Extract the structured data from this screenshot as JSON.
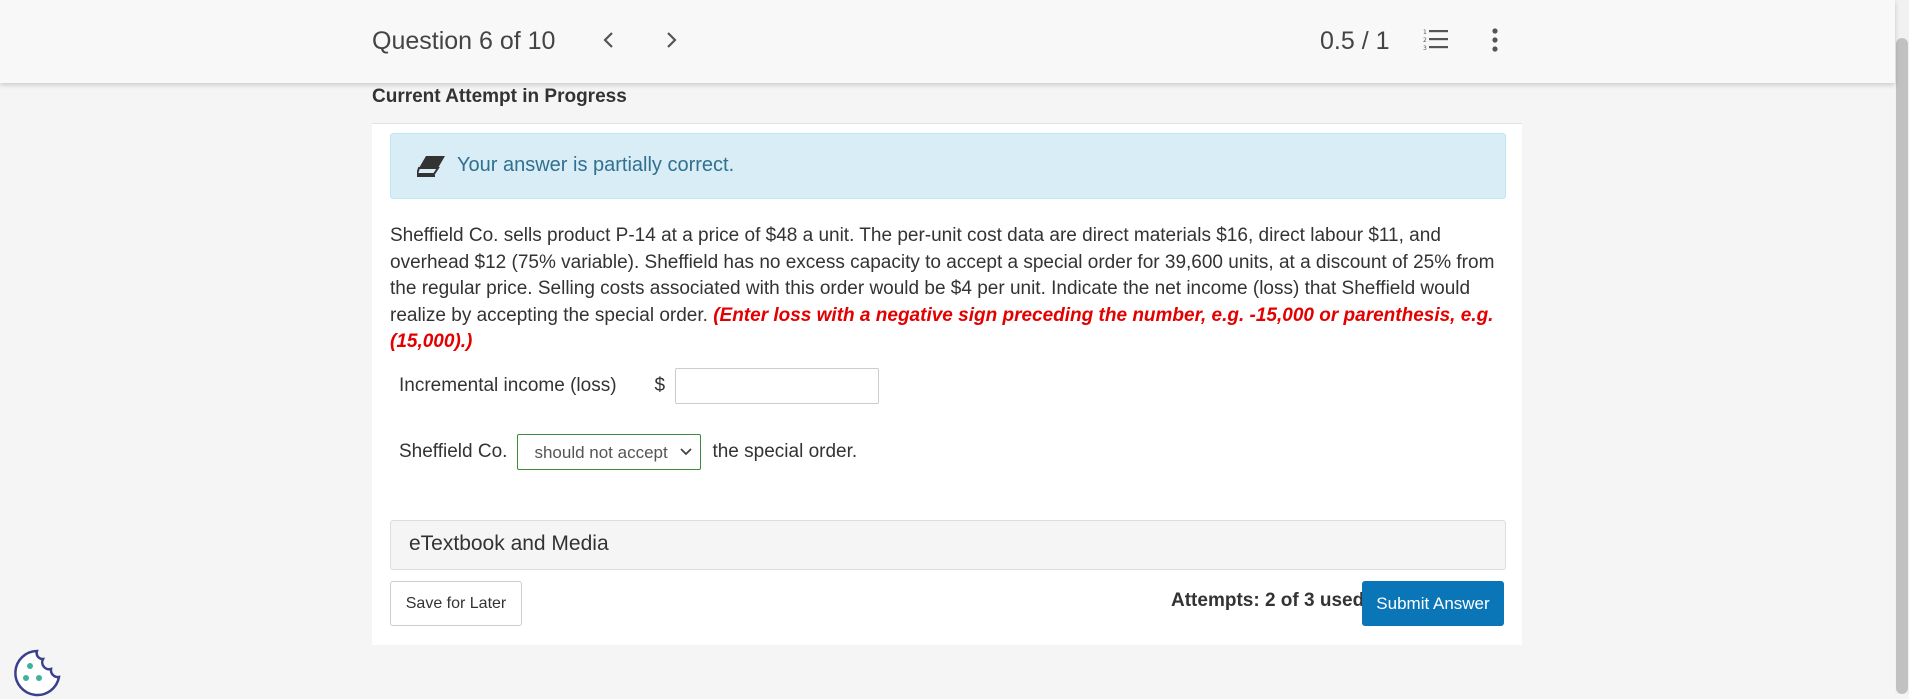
{
  "header": {
    "question_counter": "Question 6 of 10",
    "score": "0.5 / 1",
    "icons": [
      "chevron-left-icon",
      "chevron-right-icon",
      "numbered-list-icon",
      "more-vertical-icon"
    ]
  },
  "attempt_status": "Current Attempt in Progress",
  "feedback": {
    "message": "Your answer is partially correct.",
    "icon": "eraser-icon",
    "color": "#31708f",
    "background": "#d9edf7"
  },
  "question": {
    "text": "Sheffield Co. sells product P-14 at a price of $48 a unit. The per-unit cost data are direct materials $16, direct labour $11, and overhead $12 (75% variable). Sheffield has no excess capacity to accept a special order for 39,600 units, at a discount of 25% from the regular price. Selling costs associated with this order would be $4 per unit. Indicate the net income (loss) that Sheffield would realize by accepting the special order. ",
    "hint": "(Enter loss with a negative sign preceding the number, e.g. -15,000 or parenthesis, e.g. (15,000).)",
    "hint_color": "#e30000"
  },
  "incremental_income": {
    "label": "Incremental income (loss)",
    "currency": "$",
    "value": ""
  },
  "decision": {
    "prefix": "Sheffield Co.",
    "selected": "should not accept",
    "suffix": "the special order."
  },
  "etextbook": "eTextbook and Media",
  "footer": {
    "save_label": "Save for Later",
    "attempts": "Attempts: 2 of 3 used",
    "submit_label": "Submit Answer",
    "submit_color": "#0a76b8"
  }
}
